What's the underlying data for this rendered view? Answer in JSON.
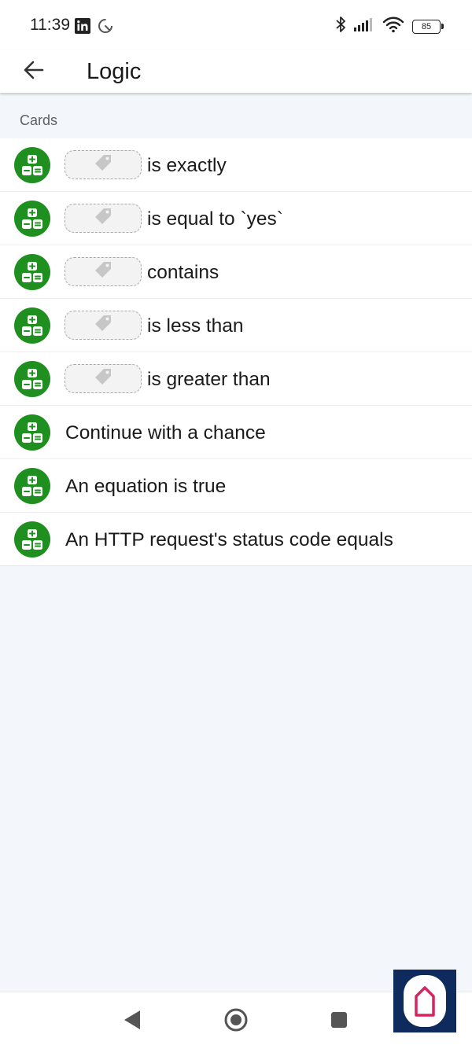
{
  "status_bar": {
    "time": "11:39",
    "battery": "85",
    "icons": [
      "linkedin-icon",
      "sync-icon",
      "bluetooth-icon",
      "signal-icon",
      "wifi-icon",
      "battery-icon"
    ]
  },
  "app_bar": {
    "title": "Logic",
    "back_icon": "arrow-left-icon"
  },
  "section": {
    "header": "Cards"
  },
  "cards": [
    {
      "label": "is exactly",
      "has_tag": true
    },
    {
      "label": "is equal to `yes`",
      "has_tag": true
    },
    {
      "label": "contains",
      "has_tag": true
    },
    {
      "label": "is less than",
      "has_tag": true
    },
    {
      "label": "is greater than",
      "has_tag": true
    },
    {
      "label": "Continue with a chance",
      "has_tag": false
    },
    {
      "label": "An equation is true",
      "has_tag": false
    },
    {
      "label": "An HTTP request's status code equals",
      "has_tag": false
    }
  ],
  "colors": {
    "card_icon": "#1f8f1f",
    "background": "#f3f6fa",
    "launcher_bg": "#0f2a5c",
    "launcher_accent": "#d6245e"
  },
  "nav_bar": {
    "icons": [
      "back-triangle-icon",
      "home-circle-icon",
      "recents-square-icon"
    ]
  }
}
